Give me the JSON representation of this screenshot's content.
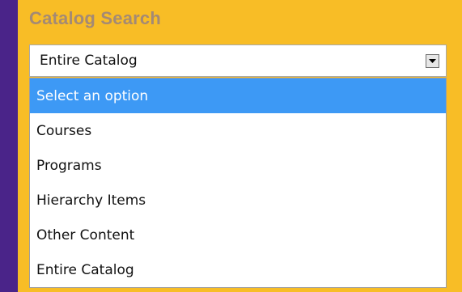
{
  "search": {
    "title": "Catalog Search",
    "selected_value": "Entire Catalog",
    "options": [
      "Select an option",
      "Courses",
      "Programs",
      "Hierarchy Items",
      "Other Content",
      "Entire Catalog"
    ],
    "highlighted_index": 0
  },
  "colors": {
    "background": "#4a2489",
    "panel": "#f8bd26",
    "title": "#a48a74",
    "highlight": "#3d99f5"
  },
  "icons": {
    "select_arrow": "chevron-down-icon"
  }
}
